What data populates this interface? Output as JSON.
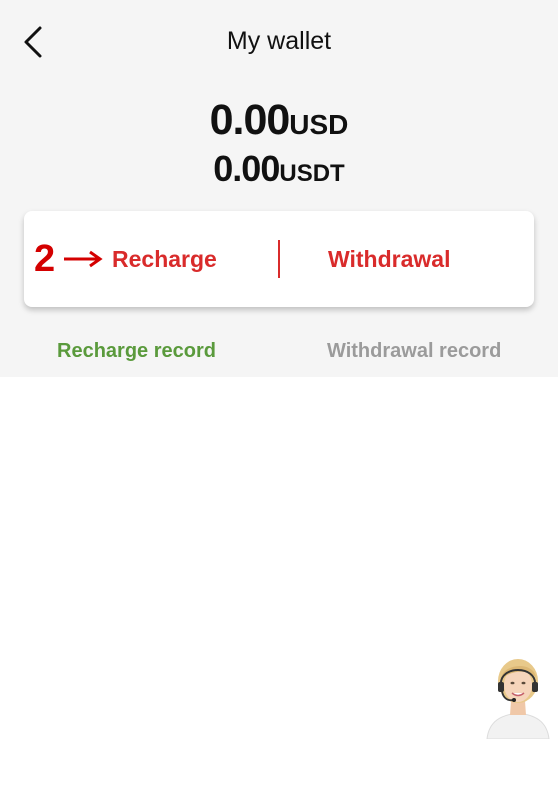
{
  "header": {
    "title": "My wallet",
    "back_icon": "chevron-left-icon"
  },
  "balances": {
    "usd": {
      "amount": "0.00",
      "unit": "USD"
    },
    "usdt": {
      "amount": "0.00",
      "unit": "USDT"
    }
  },
  "actions": {
    "recharge_label": "Recharge",
    "withdrawal_label": "Withdrawal",
    "annotation_number": "2",
    "annotation_icon": "right-arrow-icon"
  },
  "records": {
    "recharge_label": "Recharge record",
    "withdrawal_label": "Withdrawal record",
    "active": "recharge"
  },
  "support": {
    "icon": "customer-support-avatar-icon"
  },
  "colors": {
    "accent_red": "#d92b2b",
    "annotation_red": "#d40000",
    "active_tab_green": "#5a9a3c",
    "inactive_tab_gray": "#9b9b9b",
    "top_background": "#f5f5f5"
  }
}
